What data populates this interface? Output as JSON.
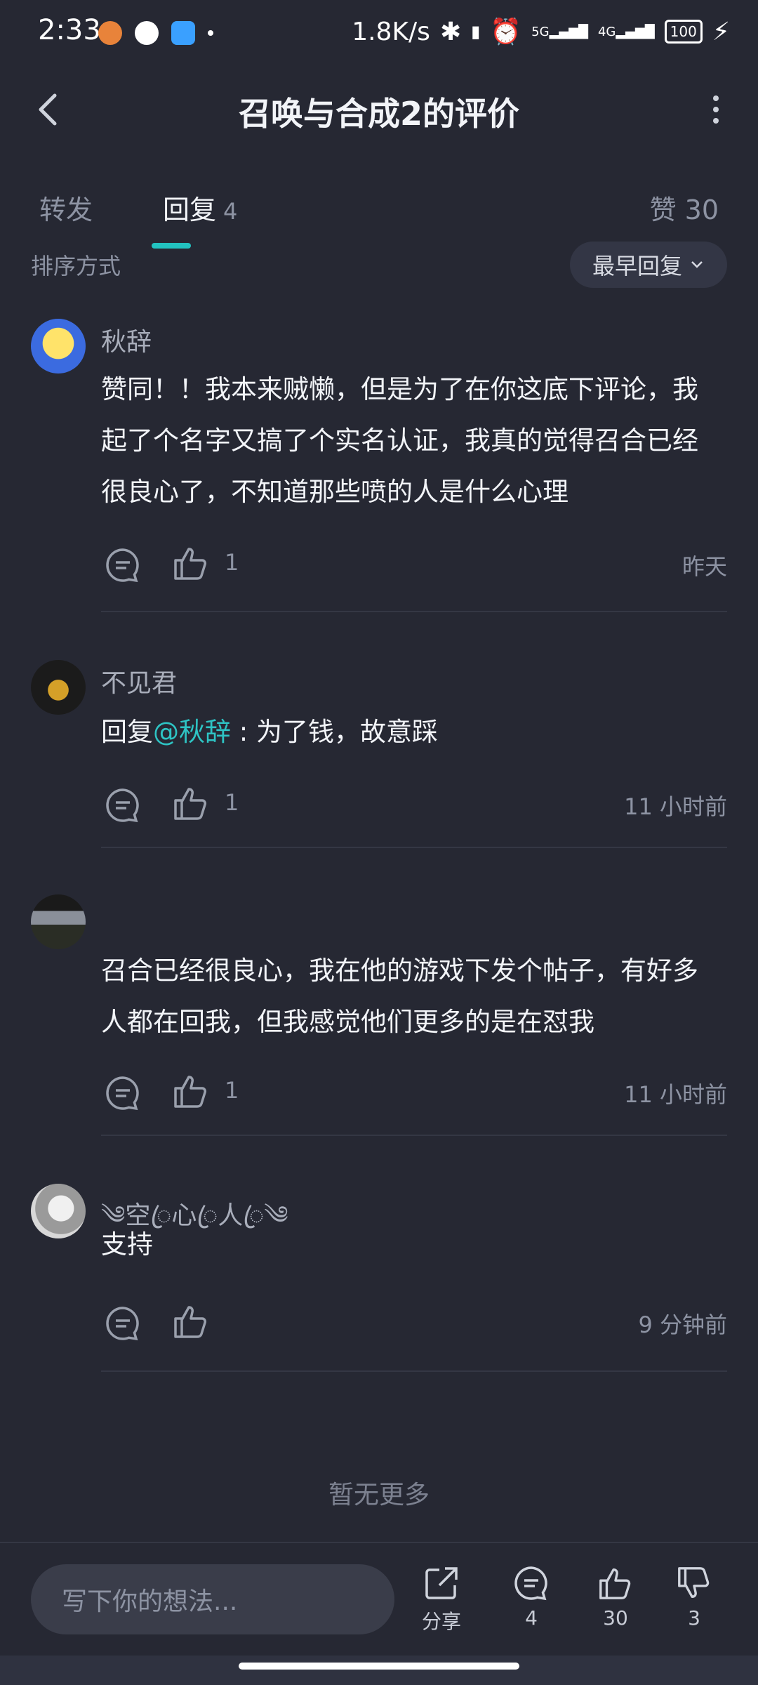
{
  "status": {
    "time": "2:33",
    "network_speed": "1.8K/s",
    "signal_5g": "5G",
    "signal_4g": "4G",
    "battery": "100"
  },
  "header": {
    "title": "召唤与合成2的评价",
    "back_icon": "chevron-left-icon",
    "more_icon": "more-vertical-icon"
  },
  "tabs": {
    "forward": "转发",
    "reply": "回复",
    "reply_count": "4",
    "like": "赞 30"
  },
  "sort": {
    "label": "排序方式",
    "value": "最早回复"
  },
  "comments": [
    {
      "name": "秋辞",
      "text": "赞同！！我本来贼懒，但是为了在你这底下评论，我起了个名字又搞了个实名认证，我真的觉得召合已经很良心了，不知道那些喷的人是什么心理",
      "likes": "1",
      "time": "昨天"
    },
    {
      "name": "不见君",
      "reply_prefix": "回复",
      "mention": "@秋辞",
      "text": " : 为了钱，故意踩",
      "likes": "1",
      "time": "11 小时前"
    },
    {
      "name": "",
      "text": "召合已经很良心，我在他的游戏下发个帖子，有好多人都在回我，但我感觉他们更多的是在怼我",
      "likes": "1",
      "time": "11 小时前"
    },
    {
      "name": "༄空ꦿ心ꦿ人ꦿ༄",
      "text": "支持",
      "likes": "",
      "time": "9 分钟前"
    }
  ],
  "footer_note": "暂无更多",
  "bottom_bar": {
    "input_placeholder": "写下你的想法...",
    "share_label": "分享",
    "comment_count": "4",
    "like_count": "30",
    "dislike_count": "3"
  },
  "colors": {
    "background": "#262833",
    "accent": "#22c3c0",
    "mention": "#2ec4c4"
  }
}
